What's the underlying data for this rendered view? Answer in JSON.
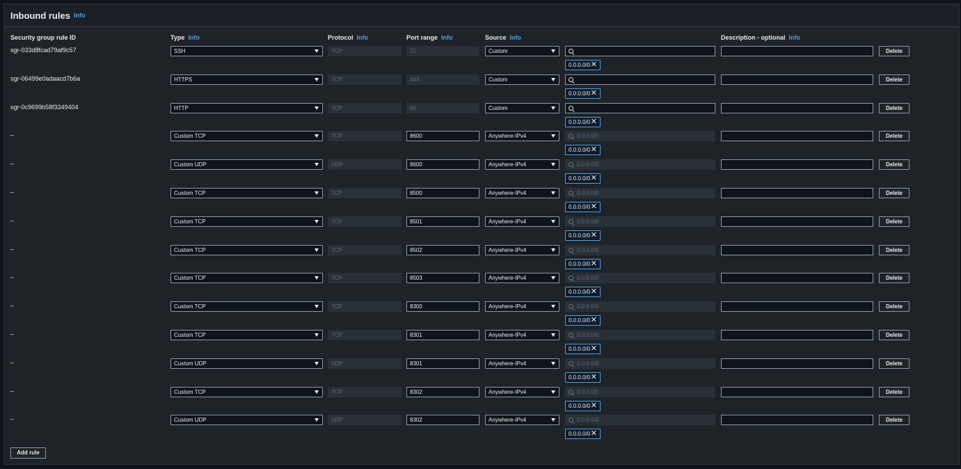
{
  "panel": {
    "title": "Inbound rules",
    "title_info": "Info"
  },
  "headers": {
    "rule_id": "Security group rule ID",
    "type": "Type",
    "type_info": "Info",
    "protocol": "Protocol",
    "protocol_info": "Info",
    "port_range": "Port range",
    "port_range_info": "Info",
    "source": "Source",
    "source_info": "Info",
    "description": "Description - optional",
    "description_info": "Info"
  },
  "rules": [
    {
      "id": "sgr-033d8fcad79af9c57",
      "type": "SSH",
      "protocol": "TCP",
      "port": "22",
      "port_editable": false,
      "source": "Custom",
      "search_placeholder": "",
      "search_enabled": true,
      "cidr": "0.0.0.0/0",
      "description": "",
      "delete": "Delete"
    },
    {
      "id": "sgr-06499e0adaacd7b6a",
      "type": "HTTPS",
      "protocol": "TCP",
      "port": "443",
      "port_editable": false,
      "source": "Custom",
      "search_placeholder": "",
      "search_enabled": true,
      "cidr": "0.0.0.0/0",
      "description": "",
      "delete": "Delete"
    },
    {
      "id": "sgr-0c9699b58f3349404",
      "type": "HTTP",
      "protocol": "TCP",
      "port": "80",
      "port_editable": false,
      "source": "Custom",
      "search_placeholder": "",
      "search_enabled": true,
      "cidr": "0.0.0.0/0",
      "description": "",
      "delete": "Delete"
    },
    {
      "id": "–",
      "type": "Custom TCP",
      "protocol": "TCP",
      "port": "8600",
      "port_editable": true,
      "source": "Anywhere-IPv4",
      "search_placeholder": "0.0.0.0/0",
      "search_enabled": false,
      "cidr": "0.0.0.0/0",
      "description": "",
      "delete": "Delete"
    },
    {
      "id": "–",
      "type": "Custom UDP",
      "protocol": "UDP",
      "port": "8600",
      "port_editable": true,
      "source": "Anywhere-IPv4",
      "search_placeholder": "0.0.0.0/0",
      "search_enabled": false,
      "cidr": "0.0.0.0/0",
      "description": "",
      "delete": "Delete"
    },
    {
      "id": "–",
      "type": "Custom TCP",
      "protocol": "TCP",
      "port": "8500",
      "port_editable": true,
      "source": "Anywhere-IPv4",
      "search_placeholder": "0.0.0.0/0",
      "search_enabled": false,
      "cidr": "0.0.0.0/0",
      "description": "",
      "delete": "Delete"
    },
    {
      "id": "–",
      "type": "Custom TCP",
      "protocol": "TCP",
      "port": "8501",
      "port_editable": true,
      "source": "Anywhere-IPv4",
      "search_placeholder": "0.0.0.0/0",
      "search_enabled": false,
      "cidr": "0.0.0.0/0",
      "description": "",
      "delete": "Delete"
    },
    {
      "id": "–",
      "type": "Custom TCP",
      "protocol": "TCP",
      "port": "8502",
      "port_editable": true,
      "source": "Anywhere-IPv4",
      "search_placeholder": "0.0.0.0/0",
      "search_enabled": false,
      "cidr": "0.0.0.0/0",
      "description": "",
      "delete": "Delete"
    },
    {
      "id": "–",
      "type": "Custom TCP",
      "protocol": "TCP",
      "port": "8503",
      "port_editable": true,
      "source": "Anywhere-IPv4",
      "search_placeholder": "0.0.0.0/0",
      "search_enabled": false,
      "cidr": "0.0.0.0/0",
      "description": "",
      "delete": "Delete"
    },
    {
      "id": "–",
      "type": "Custom TCP",
      "protocol": "TCP",
      "port": "8300",
      "port_editable": true,
      "source": "Anywhere-IPv4",
      "search_placeholder": "0.0.0.0/0",
      "search_enabled": false,
      "cidr": "0.0.0.0/0",
      "description": "",
      "delete": "Delete"
    },
    {
      "id": "–",
      "type": "Custom TCP",
      "protocol": "TCP",
      "port": "8301",
      "port_editable": true,
      "source": "Anywhere-IPv4",
      "search_placeholder": "0.0.0.0/0",
      "search_enabled": false,
      "cidr": "0.0.0.0/0",
      "description": "",
      "delete": "Delete"
    },
    {
      "id": "–",
      "type": "Custom UDP",
      "protocol": "UDP",
      "port": "8301",
      "port_editable": true,
      "source": "Anywhere-IPv4",
      "search_placeholder": "0.0.0.0/0",
      "search_enabled": false,
      "cidr": "0.0.0.0/0",
      "description": "",
      "delete": "Delete"
    },
    {
      "id": "–",
      "type": "Custom TCP",
      "protocol": "TCP",
      "port": "8302",
      "port_editable": true,
      "source": "Anywhere-IPv4",
      "search_placeholder": "0.0.0.0/0",
      "search_enabled": false,
      "cidr": "0.0.0.0/0",
      "description": "",
      "delete": "Delete"
    },
    {
      "id": "–",
      "type": "Custom UDP",
      "protocol": "UDP",
      "port": "8302",
      "port_editable": true,
      "source": "Anywhere-IPv4",
      "search_placeholder": "0.0.0.0/0",
      "search_enabled": false,
      "cidr": "0.0.0.0/0",
      "description": "",
      "delete": "Delete"
    }
  ],
  "add_rule_label": "Add rule",
  "icons": {
    "search": "search-icon",
    "remove": "close-icon",
    "dropdown": "caret-down-icon"
  },
  "colors": {
    "accent": "#539fe5",
    "background": "#1e2328",
    "input_border": "#8d99a8"
  }
}
